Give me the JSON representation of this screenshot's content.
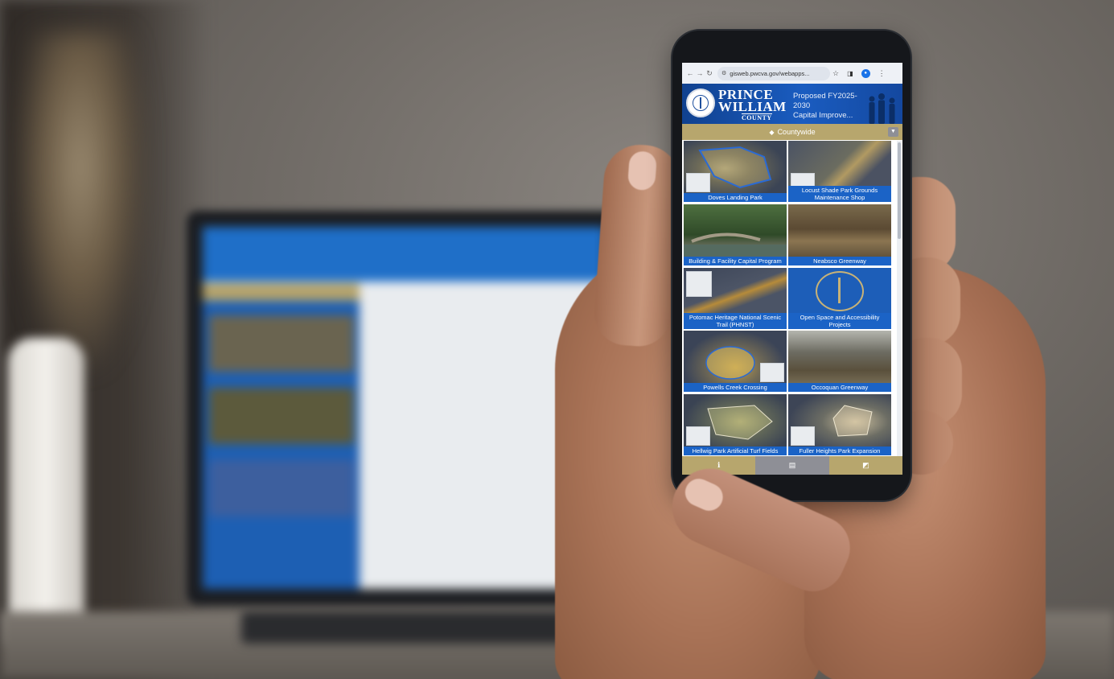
{
  "browser": {
    "url": "gisweb.pwcva.gov/webapps...",
    "icons": [
      "back-icon",
      "forward-icon",
      "reload-icon",
      "site-settings-icon",
      "bookmark-star-icon",
      "tabs-icon",
      "profile-icon",
      "menu-icon"
    ]
  },
  "header": {
    "brand_line1": "PRINCE",
    "brand_line2": "WILLIAM",
    "brand_line3": "COUNTY",
    "title_line1": "Proposed FY2025-2030",
    "title_line2": "Capital Improve..."
  },
  "filter": {
    "label": "Countywide",
    "icon": "layers-icon"
  },
  "projects": [
    {
      "name": "Doves Landing Park",
      "thumb": "aerial-map"
    },
    {
      "name": "Locust Shade Park Grounds Maintenance Shop",
      "thumb": "aerial-map"
    },
    {
      "name": "Building & Facility Capital Program",
      "thumb": "photo-bridge"
    },
    {
      "name": "Neabsco Greenway",
      "thumb": "photo-stream"
    },
    {
      "name": "Potomac Heritage National Scenic Trail (PHNST)",
      "thumb": "aerial-map"
    },
    {
      "name": "Open Space and Accessibility Projects",
      "thumb": "county-seal"
    },
    {
      "name": "Powells Creek Crossing",
      "thumb": "aerial-map"
    },
    {
      "name": "Occoquan Greenway",
      "thumb": "photo-forest"
    },
    {
      "name": "Hellwig Park Artificial Turf Fields",
      "thumb": "aerial-map"
    },
    {
      "name": "Fuller Heights Park Expansion",
      "thumb": "aerial-map"
    }
  ],
  "bottom_tabs": [
    {
      "icon": "info-icon",
      "glyph": "ℹ"
    },
    {
      "icon": "gallery-icon",
      "glyph": "▤"
    },
    {
      "icon": "map-icon",
      "glyph": "◩"
    }
  ],
  "colors": {
    "header_blue": "#1a5cc0",
    "gold": "#b7a66d",
    "caption_blue": "#1b63c6"
  }
}
